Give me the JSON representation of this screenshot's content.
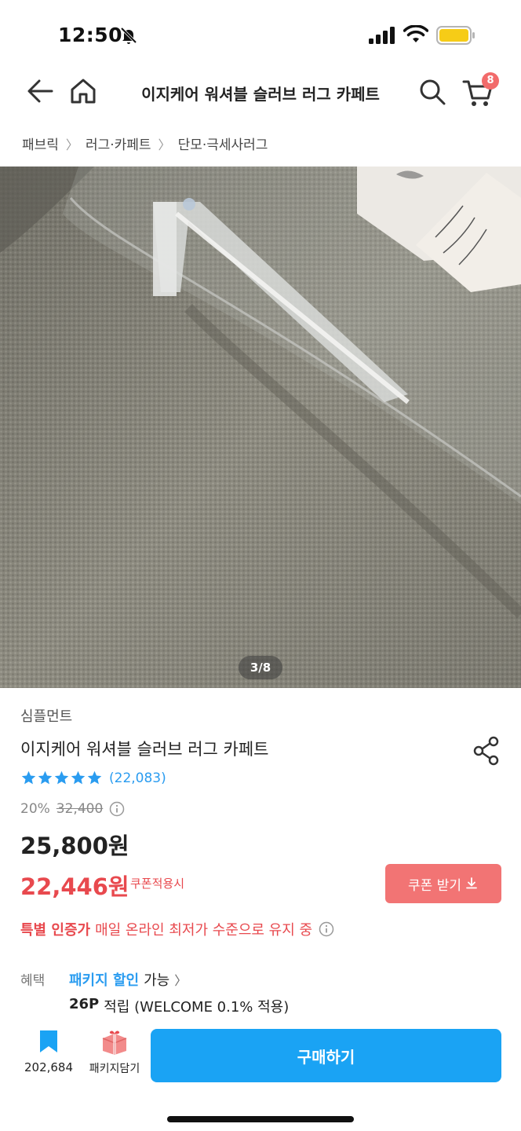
{
  "status": {
    "time": "12:50"
  },
  "nav": {
    "title": "이지케어 워셔블 슬러브 러그 카페트",
    "cart_count": "8"
  },
  "breadcrumb": [
    "패브릭",
    "러그·카페트",
    "단모·극세사러그"
  ],
  "image": {
    "counter": "3/8"
  },
  "product": {
    "brand": "심플먼트",
    "name": "이지케어 워셔블 슬러브 러그 카페트",
    "rating_stars": 5,
    "review_count": "(22,083)",
    "discount": "20%",
    "original_price": "32,400",
    "sale_price": "25,800원",
    "coupon_price": "22,446원",
    "coupon_note": "쿠폰적용시",
    "coupon_button": "쿠폰 받기"
  },
  "special": {
    "highlight": "특별 인증가",
    "text": "매일 온라인 최저가 수준으로 유지 중"
  },
  "benefits": {
    "label": "혜택",
    "package_link": "패키지 할인",
    "package_avail": "가능",
    "points": "26P",
    "points_text": "적립 (WELCOME 0.1% 적용)"
  },
  "bottom": {
    "bookmark_count": "202,684",
    "package_label": "패키지담기",
    "buy_label": "구매하기"
  },
  "colors": {
    "accent_blue": "#1aa3f4",
    "accent_red": "#e8494e",
    "coupon_button": "#f27474"
  },
  "icons": [
    "bell-off-icon",
    "signal-icon",
    "wifi-icon",
    "battery-icon",
    "back-arrow-icon",
    "home-icon",
    "search-icon",
    "cart-icon",
    "share-icon",
    "star-icon",
    "info-icon",
    "download-icon",
    "chevron-right-icon",
    "bookmark-icon",
    "package-box-icon"
  ]
}
